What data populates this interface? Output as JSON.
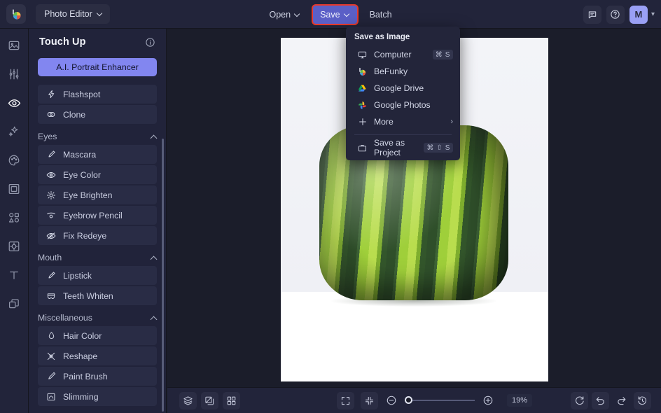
{
  "app": {
    "logo_icon": "befunky-logo-icon",
    "product_menu_label": "Photo Editor"
  },
  "toolbar": {
    "open_label": "Open",
    "save_label": "Save",
    "batch_label": "Batch",
    "save_highlight_color": "#e8392b",
    "save_bg_color": "#5b5fc7",
    "feedback_icon": "chat-icon",
    "help_icon": "question-circle-icon",
    "avatar_initial": "M"
  },
  "rail": {
    "items": [
      {
        "icon": "image-icon",
        "name": "edit",
        "active": false
      },
      {
        "icon": "sliders-icon",
        "name": "adjust",
        "active": false
      },
      {
        "icon": "eye-icon",
        "name": "touch-up",
        "active": true
      },
      {
        "icon": "sparkles-icon",
        "name": "effects",
        "active": false
      },
      {
        "icon": "palette-icon",
        "name": "artsy",
        "active": false
      },
      {
        "icon": "frame-icon",
        "name": "frames",
        "active": false
      },
      {
        "icon": "shapes-icon",
        "name": "graphics",
        "active": false
      },
      {
        "icon": "texture-icon",
        "name": "textures",
        "active": false
      },
      {
        "icon": "text-icon",
        "name": "text",
        "active": false
      },
      {
        "icon": "layers-icon",
        "name": "layers",
        "active": false
      }
    ]
  },
  "sidebar": {
    "title": "Touch Up",
    "info_icon": "info-icon",
    "ai_button_label": "A.I. Portrait Enhancer",
    "ai_button_color": "#8286f0",
    "top_tools": [
      {
        "label": "Flashspot",
        "icon": "flash-icon"
      },
      {
        "label": "Clone",
        "icon": "clone-icon"
      }
    ],
    "sections": [
      {
        "label": "Eyes",
        "collapse_icon": "chevron-up-icon",
        "items": [
          {
            "label": "Mascara",
            "icon": "mascara-icon"
          },
          {
            "label": "Eye Color",
            "icon": "eye-color-icon"
          },
          {
            "label": "Eye Brighten",
            "icon": "brighten-icon"
          },
          {
            "label": "Eyebrow Pencil",
            "icon": "eyebrow-icon"
          },
          {
            "label": "Fix Redeye",
            "icon": "redeye-icon"
          }
        ]
      },
      {
        "label": "Mouth",
        "collapse_icon": "chevron-up-icon",
        "items": [
          {
            "label": "Lipstick",
            "icon": "lipstick-icon"
          },
          {
            "label": "Teeth Whiten",
            "icon": "teeth-icon"
          }
        ]
      },
      {
        "label": "Miscellaneous",
        "collapse_icon": "chevron-up-icon",
        "items": [
          {
            "label": "Hair Color",
            "icon": "hair-color-icon"
          },
          {
            "label": "Reshape",
            "icon": "reshape-icon"
          },
          {
            "label": "Paint Brush",
            "icon": "paint-brush-icon"
          },
          {
            "label": "Slimming",
            "icon": "slimming-icon"
          }
        ]
      }
    ]
  },
  "save_menu": {
    "title": "Save as Image",
    "items": [
      {
        "label": "Computer",
        "icon": "monitor-icon",
        "shortcut": "⌘ S",
        "arrow": ""
      },
      {
        "label": "BeFunky",
        "icon": "befunky-icon",
        "shortcut": "",
        "arrow": ""
      },
      {
        "label": "Google Drive",
        "icon": "google-drive-icon",
        "shortcut": "",
        "arrow": ""
      },
      {
        "label": "Google Photos",
        "icon": "google-photos-icon",
        "shortcut": "",
        "arrow": ""
      },
      {
        "label": "More",
        "icon": "plus-icon",
        "shortcut": "",
        "arrow": "›"
      }
    ],
    "project_item": {
      "label": "Save as Project",
      "icon": "briefcase-icon",
      "shortcut": "⌘ ⇧ S"
    }
  },
  "canvas": {
    "image_subject": "square-watermelon-photo",
    "background_color": "#f7f8fb"
  },
  "bottombar": {
    "left_icons": [
      {
        "icon": "layers-stack-icon",
        "name": "layers-button"
      },
      {
        "icon": "compare-icon",
        "name": "compare-button"
      },
      {
        "icon": "grid-icon",
        "name": "grid-button"
      }
    ],
    "fit_icons": [
      {
        "icon": "fit-screen-icon",
        "name": "fit-to-screen-button"
      },
      {
        "icon": "actual-size-icon",
        "name": "actual-size-button"
      }
    ],
    "zoom_out_icon": "zoom-out-icon",
    "zoom_in_icon": "zoom-in-icon",
    "zoom_value": "19%",
    "zoom_slider_percent": 6,
    "right_icons": [
      {
        "icon": "reset-icon",
        "name": "reset-button"
      },
      {
        "icon": "undo-icon",
        "name": "undo-button"
      },
      {
        "icon": "redo-icon",
        "name": "redo-button"
      },
      {
        "icon": "history-icon",
        "name": "history-button"
      }
    ]
  }
}
